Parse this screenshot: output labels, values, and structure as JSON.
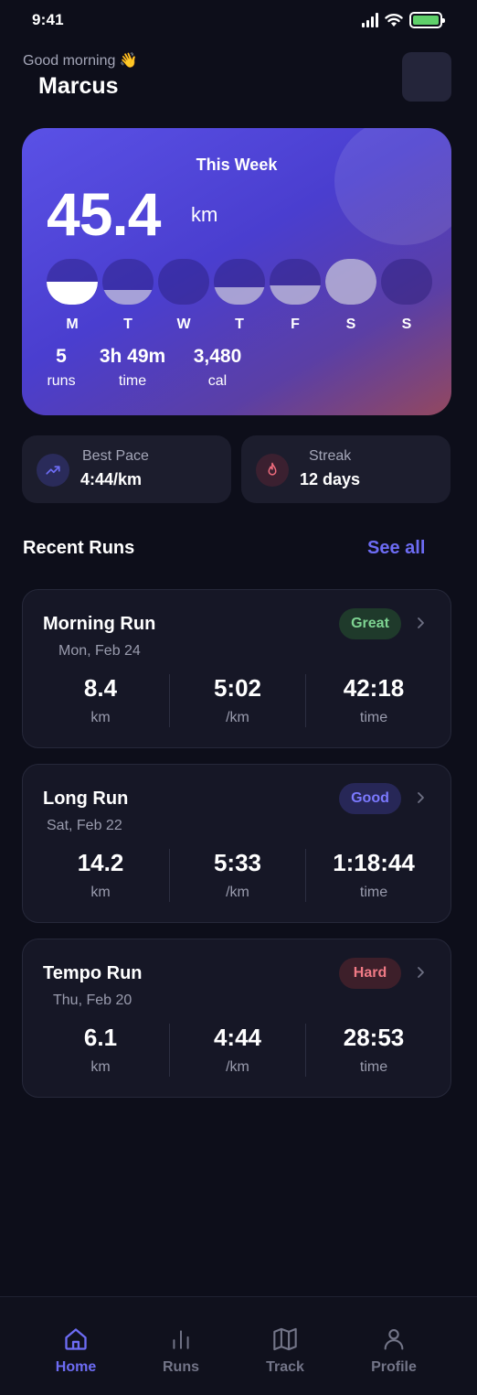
{
  "status_bar": {
    "time": "9:41"
  },
  "header": {
    "greeting": "Good morning 👋",
    "user_name": "Marcus"
  },
  "week": {
    "title": "This Week",
    "distance": "45.4",
    "unit": "km",
    "days": [
      {
        "label": "M",
        "level": 0.5,
        "full": true
      },
      {
        "label": "T",
        "level": 0.32,
        "full": false
      },
      {
        "label": "W",
        "level": 0,
        "full": false
      },
      {
        "label": "T",
        "level": 0.38,
        "full": false
      },
      {
        "label": "F",
        "level": 0.42,
        "full": false
      },
      {
        "label": "S",
        "level": 1,
        "full": false
      },
      {
        "label": "S",
        "level": 0,
        "full": false
      }
    ],
    "summary": [
      {
        "value": "5",
        "label": "runs"
      },
      {
        "value": "3h 49m",
        "label": "time"
      },
      {
        "value": "3,480",
        "label": "cal"
      }
    ]
  },
  "stats": {
    "best_pace": {
      "label": "Best Pace",
      "value": "4:44/km",
      "icon": "trending-up-icon",
      "color": "#6d6cf4"
    },
    "streak": {
      "label": "Streak",
      "value": "12 days",
      "icon": "flame-icon",
      "color": "#f06c7d"
    }
  },
  "recent": {
    "title": "Recent Runs",
    "see_all": "See all",
    "runs": [
      {
        "name": "Morning Run",
        "date": "Mon, Feb 24",
        "badge": "Great",
        "badge_fg": "#7ed492",
        "badge_bg": "#1f3a2b",
        "distance": "8.4",
        "distance_unit": "km",
        "pace": "5:02",
        "pace_unit": "/km",
        "time": "42:18",
        "time_label": "time"
      },
      {
        "name": "Long Run",
        "date": "Sat, Feb 22",
        "badge": "Good",
        "badge_fg": "#7b79ff",
        "badge_bg": "#272757",
        "distance": "14.2",
        "distance_unit": "km",
        "pace": "5:33",
        "pace_unit": "/km",
        "time": "1:18:44",
        "time_label": "time"
      },
      {
        "name": "Tempo Run",
        "date": "Thu, Feb 20",
        "badge": "Hard",
        "badge_fg": "#f07a85",
        "badge_bg": "#3d1f2a",
        "distance": "6.1",
        "distance_unit": "km",
        "pace": "4:44",
        "pace_unit": "/km",
        "time": "28:53",
        "time_label": "time"
      }
    ]
  },
  "tabs": [
    {
      "label": "Home",
      "icon": "home-icon",
      "active": true
    },
    {
      "label": "Runs",
      "icon": "bar-chart-icon",
      "active": false
    },
    {
      "label": "Track",
      "icon": "map-icon",
      "active": false
    },
    {
      "label": "Profile",
      "icon": "profile-icon",
      "active": false
    }
  ]
}
